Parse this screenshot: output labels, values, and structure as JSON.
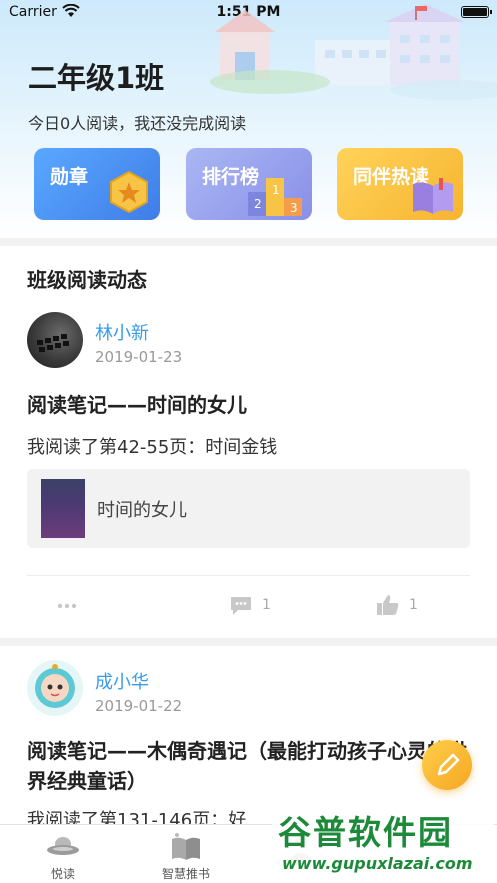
{
  "status_bar": {
    "carrier": "Carrier",
    "time": "1:51 PM"
  },
  "header": {
    "class_title": "二年级1班",
    "summary": "今日0人阅读，我还没完成阅读"
  },
  "quick_cards": [
    {
      "label": "勋章",
      "icon": "medal-icon",
      "color": "#4a90f0"
    },
    {
      "label": "排行榜",
      "icon": "podium-icon",
      "color": "#9aa0ee"
    },
    {
      "label": "同伴热读",
      "icon": "book-icon",
      "color": "#f8c240"
    }
  ],
  "feed": {
    "section_title": "班级阅读动态",
    "posts": [
      {
        "user": "林小新",
        "date": "2019-01-23",
        "title": "阅读笔记——时间的女儿",
        "excerpt": "我阅读了第42-55页：时间金钱",
        "book_title": "时间的女儿",
        "comments": "1",
        "likes": "1"
      },
      {
        "user": "成小华",
        "date": "2019-01-22",
        "title": "阅读笔记——木偶奇遇记（最能打动孩子心灵的世界经典童话）",
        "excerpt": "我阅读了第131-146页：好"
      }
    ]
  },
  "tabbar": {
    "tabs": [
      {
        "label": "悦读",
        "icon": "ufo-icon"
      },
      {
        "label": "智慧推书",
        "icon": "open-book-icon"
      },
      {
        "label": "",
        "icon": "profile-icon"
      }
    ]
  },
  "watermark": {
    "title": "谷普软件园",
    "url": "www.gupuxlazai.com"
  },
  "colors": {
    "accent_blue": "#3a9be8",
    "fab_orange": "#f5a623",
    "watermark_green": "#1d8a3a"
  }
}
